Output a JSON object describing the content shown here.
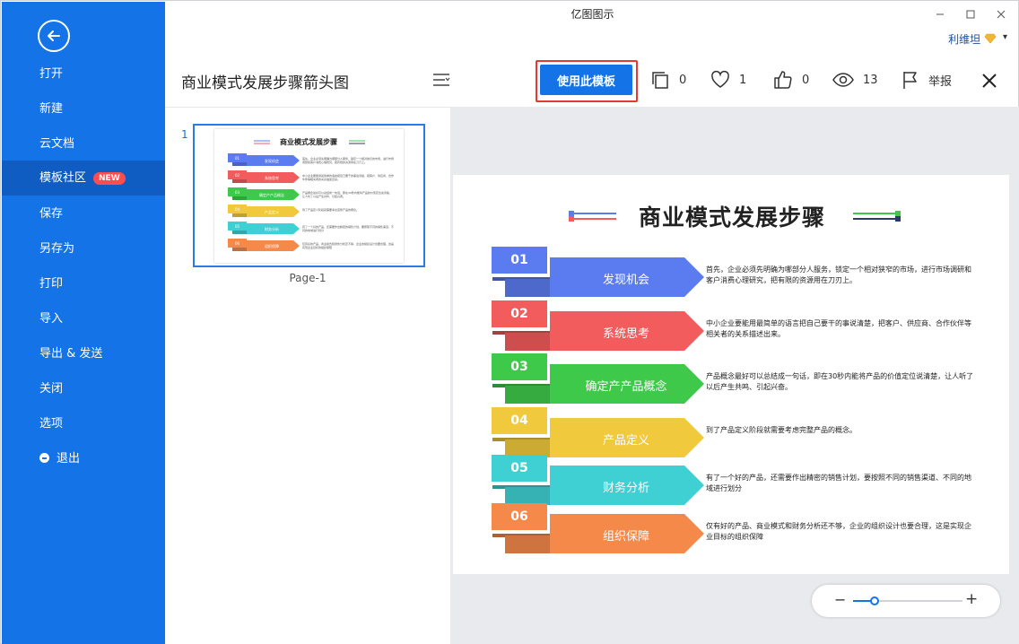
{
  "window": {
    "title": "亿图图示"
  },
  "user": {
    "name": "利维坦",
    "vip_caret": "▾"
  },
  "sidebar": {
    "items": [
      {
        "label": "打开"
      },
      {
        "label": "新建"
      },
      {
        "label": "云文档"
      },
      {
        "label": "模板社区",
        "badge": "NEW",
        "active": true
      },
      {
        "label": "保存"
      },
      {
        "label": "另存为"
      },
      {
        "label": "打印"
      },
      {
        "label": "导入"
      },
      {
        "label": "导出 & 发送"
      },
      {
        "label": "关闭"
      },
      {
        "label": "选项"
      },
      {
        "label": "退出"
      }
    ]
  },
  "header": {
    "doc_title": "商业模式发展步骤箭头图",
    "use_template": "使用此模板",
    "duplicates": "0",
    "likes": "1",
    "thumbs_up": "0",
    "views": "13",
    "report": "举报"
  },
  "thumbnails": {
    "page_number": "1",
    "page_label": "Page-1"
  },
  "infographic": {
    "title": "商业模式发展步骤",
    "steps": [
      {
        "num": "01",
        "label": "发现机会",
        "color": "#5b7cf0",
        "desc": "首先，企业必须先明确为哪部分人服务，锁定一个相对狭窄的市场，进行市场调研和客户消费心理研究，把有限的资源用在刀刃上。"
      },
      {
        "num": "02",
        "label": "系统思考",
        "color": "#f25c5c",
        "desc": "中小企业要能用最简单的语言把自己要干的事说清楚，把客户、供应商、合作伙伴等相关者的关系描述出来。"
      },
      {
        "num": "03",
        "label": "确定产产品概念",
        "color": "#3fc94a",
        "desc": "产品概念最好可以总结成一句话，即在30秒内能将产品的价值定位说清楚，让人听了以后产生共鸣、引起兴奋。"
      },
      {
        "num": "04",
        "label": "产品定义",
        "color": "#f0c93c",
        "desc": "到了产品定义阶段就需要考虑完整产品的概念。"
      },
      {
        "num": "05",
        "label": "财务分析",
        "color": "#3fd0d4",
        "desc": "有了一个好的产品，还需要作出精密的销售计划，要按照不同的销售渠道、不同的地域进行划分"
      },
      {
        "num": "06",
        "label": "组织保障",
        "color": "#f5894a",
        "desc": "仅有好的产品、商业模式和财务分析还不够，企业的组织设计也要合理，这是实现企业目标的组织保障"
      }
    ]
  },
  "zoom": {
    "minus": "−",
    "plus": "+",
    "level": 0.2
  }
}
